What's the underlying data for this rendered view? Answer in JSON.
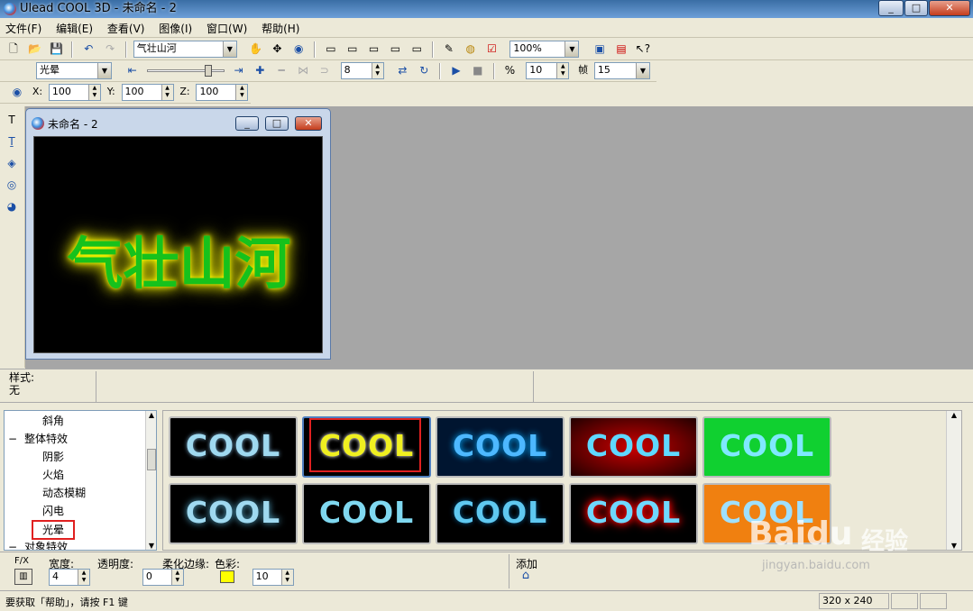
{
  "window": {
    "title": "Ulead COOL 3D - 未命名 - 2"
  },
  "menu": [
    "文件(F)",
    "编辑(E)",
    "查看(V)",
    "图像(I)",
    "窗口(W)",
    "帮助(H)"
  ],
  "toolbar1": {
    "text_object": "气壮山河",
    "zoom": "100%"
  },
  "toolbar2": {
    "effect": "光晕",
    "frame_value": "8",
    "fps_value": "10",
    "frame_label": "帧",
    "frame_count": "15",
    "fps_label": "fps"
  },
  "toolbar3": {
    "x_label": "X:",
    "x_value": "100",
    "y_label": "Y:",
    "y_value": "100",
    "z_label": "Z:",
    "z_value": "100"
  },
  "document": {
    "title": "未命名 - 2",
    "canvas_text": "气壮山河"
  },
  "stylebar": {
    "label": "样式:",
    "value": "无"
  },
  "tree": {
    "items": [
      "斜角",
      "整体特效",
      "阴影",
      "火焰",
      "动态模糊",
      "闪电",
      "光晕",
      "对象特效"
    ],
    "toggle_minus": "−"
  },
  "thumbs": {
    "label": "COOL",
    "selected_index": 1
  },
  "props": {
    "fx": "F/X",
    "width_label": "宽度:",
    "width_value": "4",
    "opacity_label": "透明度:",
    "opacity_value": "0",
    "soft_label": "柔化边缘:",
    "soft_value": "10",
    "color_label": "色彩:",
    "color": "#ffff00",
    "add_label": "添加"
  },
  "status": {
    "help": "要获取「帮助」，请按 F1 键",
    "size": "320 x 240"
  },
  "watermark": {
    "brand": "Baidu",
    "cn": "经验",
    "url": "jingyan.baidu.com"
  }
}
